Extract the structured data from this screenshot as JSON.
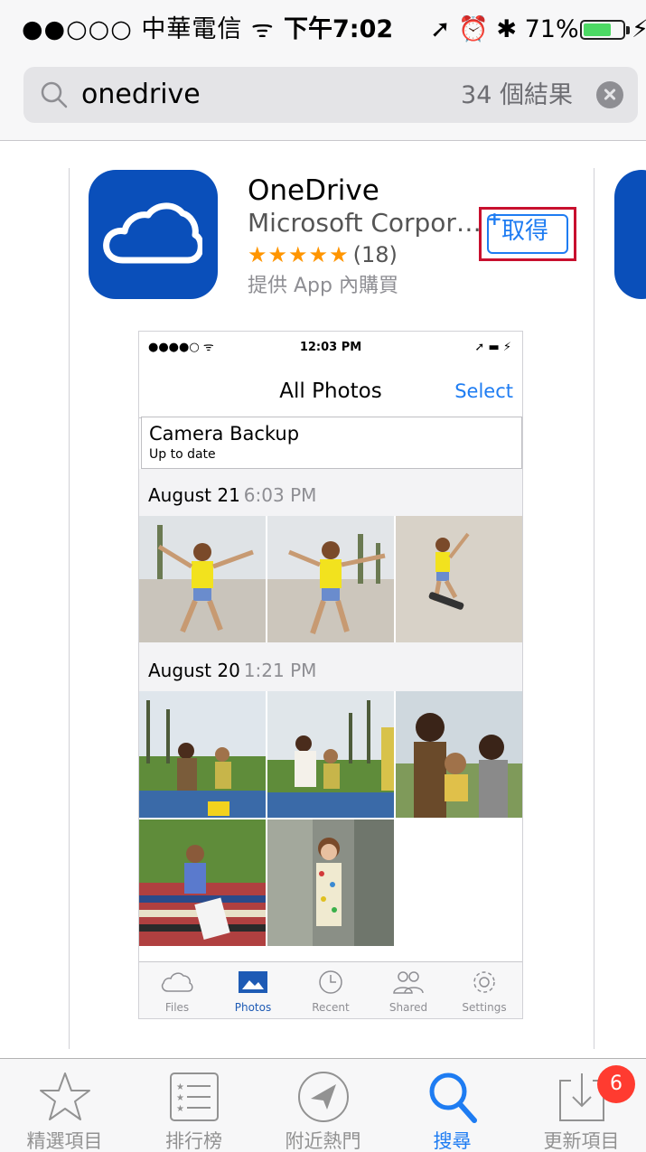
{
  "status_bar": {
    "carrier": "●●○○○ 中華電信 ᯤ",
    "time": "下午7:02",
    "right": "➚ ⏰ ✱ 71%",
    "battery_percent": 71,
    "charging_icon": "⚡"
  },
  "search": {
    "query": "onedrive",
    "result_count": "34 個結果",
    "icons": {
      "search": "search-icon",
      "clear": "clear-icon"
    }
  },
  "app": {
    "name": "OneDrive",
    "developer": "Microsoft Corpor…",
    "stars": "★★★★★",
    "rating_count": "(18)",
    "in_app_purchase": "提供 App 內購買",
    "get_plus": "+",
    "get_label": "取得",
    "icon_color": "#0a4fba",
    "accent": "#1e7cf2",
    "highlight_border": "#c8102e"
  },
  "preview": {
    "status_left": "●●●●○ ᯤ",
    "status_time": "12:03 PM",
    "status_right": "➚ ▬ ⚡",
    "title": "All Photos",
    "select_label": "Select",
    "backup_title": "Camera Backup",
    "backup_status": "Up to date",
    "groups": [
      {
        "date": "August 21",
        "time": "6:03 PM"
      },
      {
        "date": "August 20",
        "time": "1:21 PM"
      }
    ],
    "tabs": [
      {
        "label": "Files",
        "icon": "cloud-icon"
      },
      {
        "label": "Photos",
        "icon": "photos-icon"
      },
      {
        "label": "Recent",
        "icon": "clock-icon"
      },
      {
        "label": "Shared",
        "icon": "people-icon"
      },
      {
        "label": "Settings",
        "icon": "gear-icon"
      }
    ]
  },
  "tabbar": {
    "tabs": [
      {
        "label": "精選項目",
        "icon": "star-icon"
      },
      {
        "label": "排行榜",
        "icon": "list-icon"
      },
      {
        "label": "附近熱門",
        "icon": "location-icon"
      },
      {
        "label": "搜尋",
        "icon": "search-icon"
      },
      {
        "label": "更新項目",
        "icon": "download-icon"
      }
    ],
    "updates_badge": "6"
  }
}
